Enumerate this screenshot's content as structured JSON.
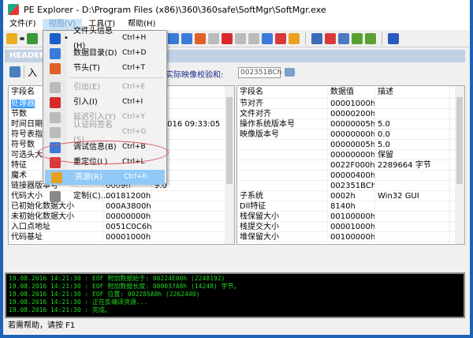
{
  "title": "PE Explorer - D:\\Program Files (x86)\\360\\360safe\\SoftMgr\\SoftMgr.exe",
  "menubar": [
    "文件(F)",
    "视图(V)",
    "工具(T)",
    "帮助(H)"
  ],
  "header_label": "HEADER",
  "toolbar2": {
    "import_label": "入",
    "checksum_label": "实际映像校验和:",
    "checksum_value": "002351BCh"
  },
  "view_menu": [
    {
      "label": "文件头信息(H)",
      "shortcut": "Ctrl+H",
      "checked": true,
      "color": "#1a5fc8"
    },
    {
      "label": "数据目录(D)",
      "shortcut": "Ctrl+D",
      "color": "#3a7ad8"
    },
    {
      "label": "节头(T)",
      "shortcut": "Ctrl+T",
      "color": "#e0602a"
    },
    {
      "sep": true
    },
    {
      "label": "引出(E)",
      "shortcut": "Ctrl+E",
      "disabled": true,
      "color": "#bbbbbb"
    },
    {
      "label": "引入(I)",
      "shortcut": "Ctrl+I",
      "color": "#d82a2a"
    },
    {
      "label": "延迟引入(Y)",
      "shortcut": "Ctrl+Y",
      "disabled": true,
      "color": "#bbbbbb"
    },
    {
      "label": "认证码签名(S)",
      "shortcut": "Ctrl+G",
      "disabled": true,
      "color": "#bbbbbb"
    },
    {
      "label": "调试信息(B)",
      "shortcut": "Ctrl+B",
      "color": "#3a7ad8"
    },
    {
      "label": "重定位(L)",
      "shortcut": "Ctrl+L",
      "color": "#d83a3a"
    },
    {
      "label": "资源(R)",
      "shortcut": "Ctrl+R",
      "highlighted": true,
      "color": "#e8a020"
    },
    {
      "sep": true
    },
    {
      "label": "定制(C)...",
      "shortcut": "",
      "color": "#888888"
    }
  ],
  "left_table": {
    "headers": [
      "字段名",
      "",
      ""
    ],
    "rows": [
      [
        "处理器",
        "",
        ""
      ],
      [
        "节数",
        "",
        ""
      ],
      [
        "时间日期",
        "",
        "7/2016 09:33:05"
      ],
      [
        "符号表指",
        "",
        ""
      ],
      [
        "符号数",
        "",
        ""
      ],
      [
        "可选头大",
        "",
        ""
      ],
      [
        "特征",
        "",
        ""
      ],
      [
        "魔术",
        "",
        ""
      ],
      [
        "链接器版本号",
        "0009h",
        "9.0"
      ],
      [
        "代码大小",
        "00181200h",
        ""
      ],
      [
        "已初始化数据大小",
        "000A3800h",
        ""
      ],
      [
        "未初始化数据大小",
        "00000000h",
        ""
      ],
      [
        "入口点地址",
        "0051C0C6h",
        ""
      ],
      [
        "代码基址",
        "00001000h",
        ""
      ]
    ]
  },
  "right_table": {
    "headers": [
      "字段名",
      "数据值",
      "描述"
    ],
    "rows": [
      [
        "节对齐",
        "00001000h",
        ""
      ],
      [
        "文件对齐",
        "00000200h",
        ""
      ],
      [
        "操作系统版本号",
        "00000005h",
        "5.0"
      ],
      [
        "映像版本号",
        "00000000h",
        "0.0"
      ],
      [
        "",
        "00000005h",
        "5.0"
      ],
      [
        "",
        "00000000h",
        "保留"
      ],
      [
        "",
        "0022F000h",
        "2289664 字节"
      ],
      [
        "",
        "00000400h",
        ""
      ],
      [
        "",
        "002351BCh",
        ""
      ],
      [
        "子系统",
        "0002h",
        "Win32 GUI"
      ],
      [
        "Dll特征",
        "8140h",
        ""
      ],
      [
        "栈保留大小",
        "00100000h",
        ""
      ],
      [
        "栈提交大小",
        "00001000h",
        ""
      ],
      [
        "堆保留大小",
        "00100000h",
        ""
      ]
    ]
  },
  "log": [
    "19.08.2016 14:21:30 : EOF 附加数据始于: 00224E00h (2248192)",
    "19.08.2016 14:21:30 : EOF 附加数据长度: 000037A8h (14248) 字节。",
    "19.08.2016 14:21:30 : EOF 位置: 002285A8h (2262440)",
    "19.08.2016 14:21:30 : 正在反编译资源...",
    "19.08.2016 14:21:30 : 完成。"
  ],
  "status": "若需帮助，请按 F1"
}
